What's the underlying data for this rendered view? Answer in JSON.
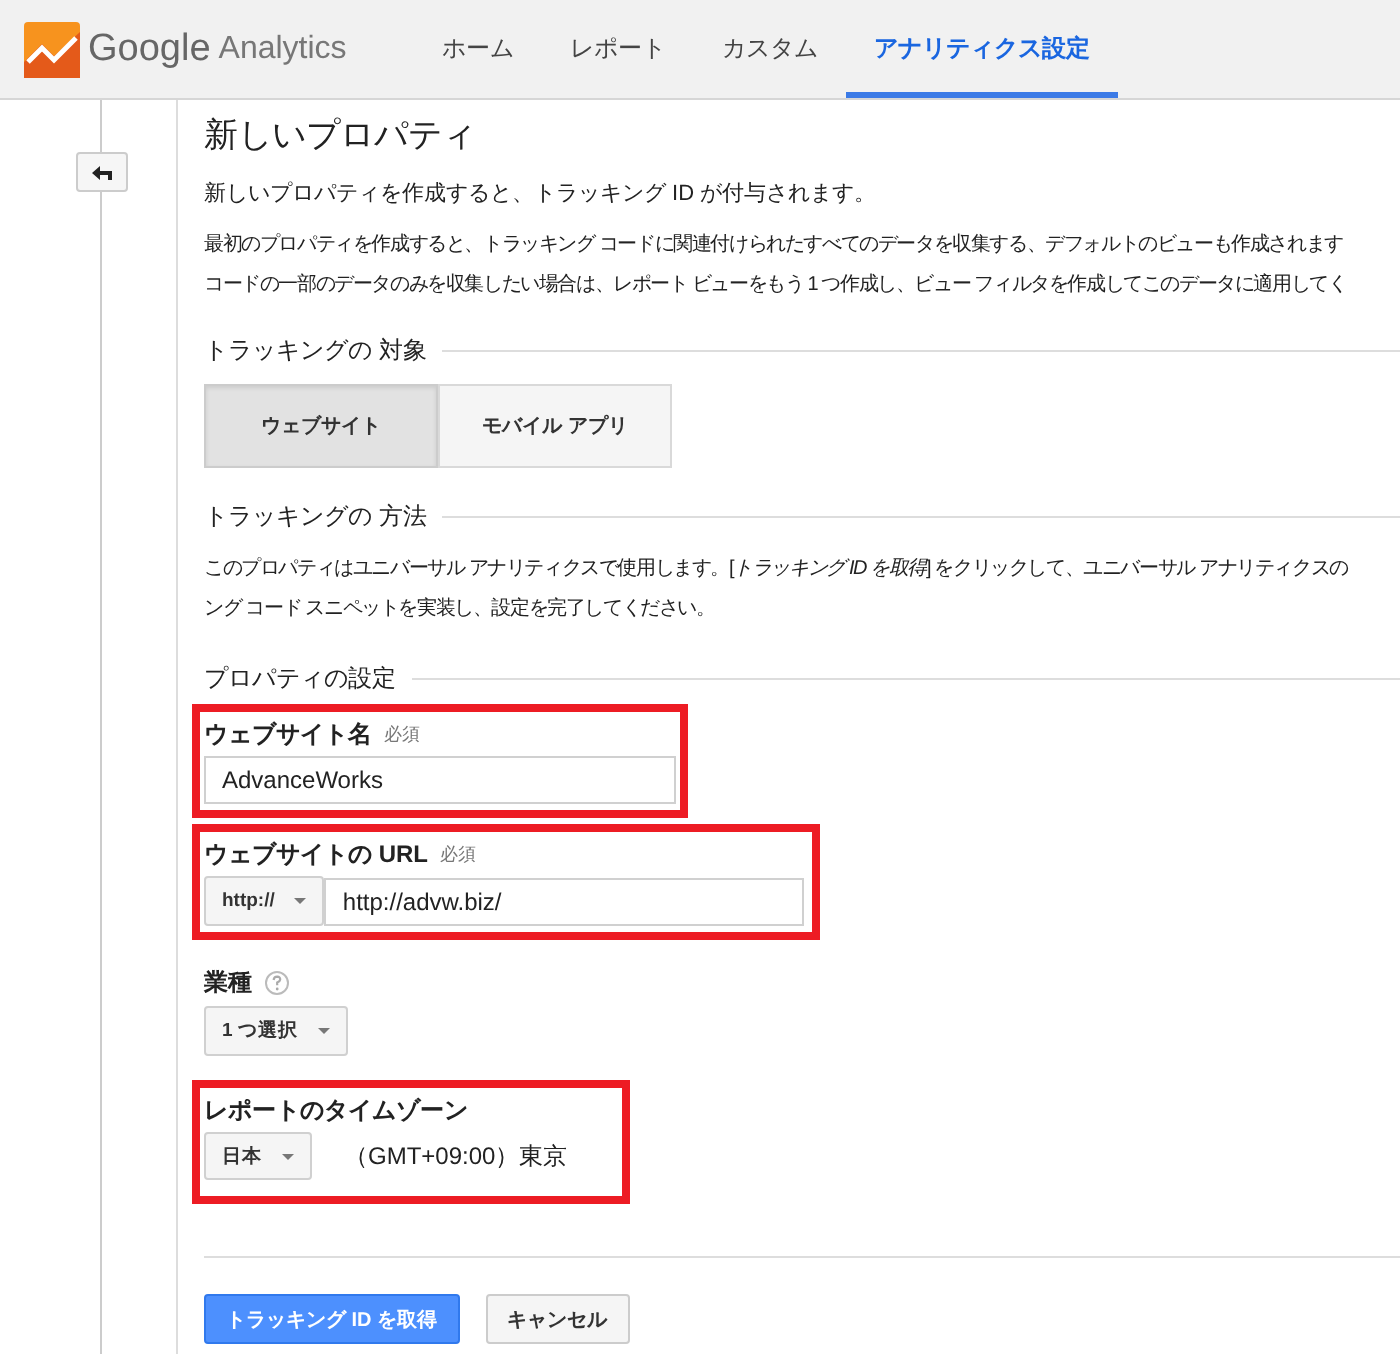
{
  "header": {
    "logo_text": "Google",
    "logo_subtext": "Analytics",
    "tabs": [
      {
        "label": "ホーム",
        "selected": false
      },
      {
        "label": "レポート",
        "selected": false
      },
      {
        "label": "カスタム",
        "selected": false
      },
      {
        "label": "アナリティクス設定",
        "selected": true
      }
    ]
  },
  "page": {
    "title": "新しいプロパティ",
    "intro": "新しいプロパティを作成すると、トラッキング ID が付与されます。",
    "description_lines": [
      "最初のプロパティを作成すると、トラッキング コードに関連付けられたすべてのデータを収集する、デフォルトのビューも作成されます",
      "コードの一部のデータのみを収集したい場合は、レポート ビューをもう 1 つ作成し、ビュー フィルタを作成してこのデータに適用してく"
    ]
  },
  "tracking_target": {
    "heading": "トラッキングの 対象",
    "options": [
      {
        "label": "ウェブサイト",
        "selected": true
      },
      {
        "label": "モバイル アプリ",
        "selected": false
      }
    ]
  },
  "tracking_method": {
    "heading": "トラッキングの 方法",
    "lines": [
      "このプロパティはユニバーサル アナリティクスで使用します。[*トラッキング ID を取得*] をクリックして、ユニバーサル アナリティクスの",
      "ング コード スニペットを実装し、設定を完了してください。"
    ]
  },
  "property_settings": {
    "heading": "プロパティの設定",
    "website_name": {
      "label": "ウェブサイト名",
      "required": "必須",
      "value": "AdvanceWorks"
    },
    "website_url": {
      "label": "ウェブサイトの URL",
      "required": "必須",
      "protocol": "http://",
      "value": "http://advw.biz/"
    },
    "industry": {
      "label": "業種",
      "select": "1 つ選択"
    },
    "timezone": {
      "label": "レポートのタイムゾーン",
      "country": "日本",
      "zone": "（GMT+09:00）東京"
    }
  },
  "buttons": [
    {
      "label": "トラッキング ID を取得",
      "kind": "primary"
    },
    {
      "label": "キャンセル",
      "kind": "secondary"
    }
  ]
}
